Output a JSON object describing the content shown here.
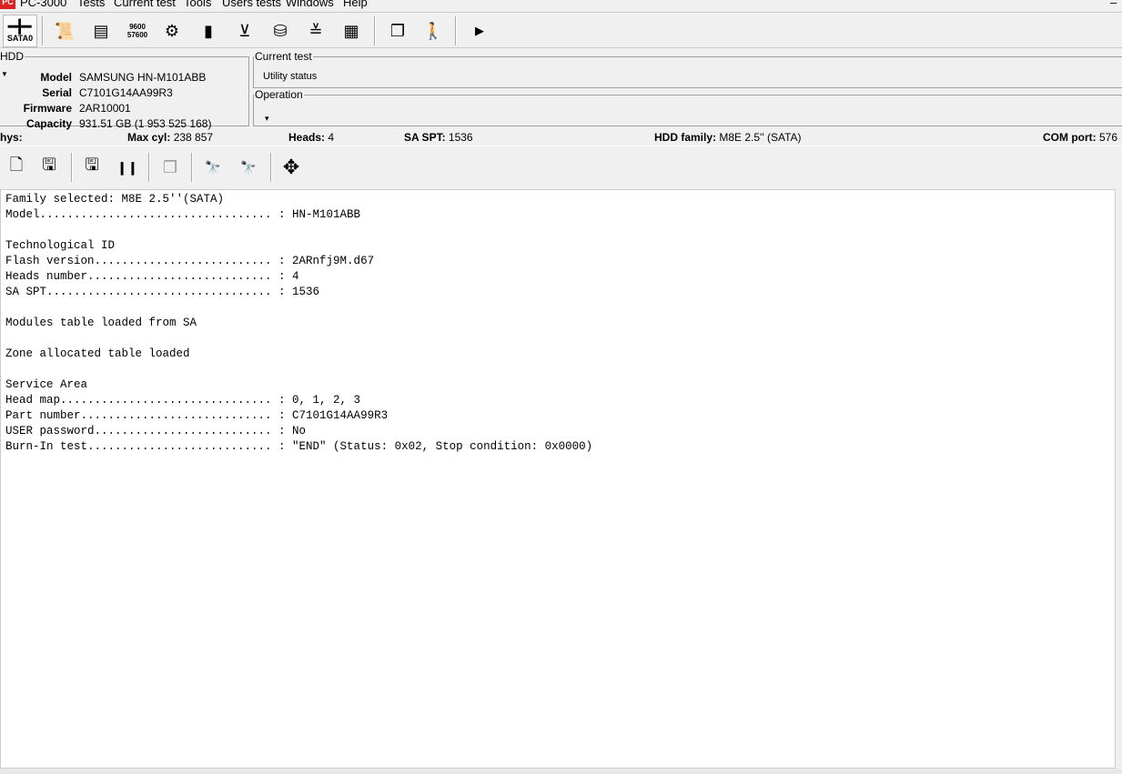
{
  "menu": {
    "app": "PC-3000",
    "items": [
      "Tests",
      "Current test",
      "Tools",
      "Users tests",
      "Windows",
      "Help"
    ]
  },
  "toolbar": {
    "port_label": "SATA0",
    "icons": [
      "info-scroll-icon",
      "drive-card-icon",
      "baud-rate-icon",
      "settings-disk-icon",
      "chip-icon",
      "ruler-icon",
      "disk-drop-icon",
      "heads-icon",
      "grid-icon",
      "windows-icon",
      "exit-icon",
      "play-icon"
    ],
    "baud": [
      "9600",
      "57600"
    ]
  },
  "hdd": {
    "legend": "HDD",
    "model_label": "Model",
    "model": "SAMSUNG HN-M101ABB",
    "serial_label": "Serial",
    "serial": "C7101G14AA99R3",
    "firmware_label": "Firmware",
    "firmware": "2AR10001",
    "capacity_label": "Capacity",
    "capacity": "931.51 GB (1 953 525 168)"
  },
  "current_test": {
    "legend": "Current test",
    "value": "Utility status"
  },
  "operation": {
    "legend": "Operation",
    "value": "▾"
  },
  "status": {
    "phys_label": "hys:",
    "maxcyl_label": "Max cyl:",
    "maxcyl": "238 857",
    "heads_label": "Heads:",
    "heads": "4",
    "saspt_label": "SA SPT:",
    "saspt": "1536",
    "family_label": "HDD family:",
    "family": "M8E 2.5'' (SATA)",
    "com_label": "COM port:",
    "com": "576"
  },
  "log": {
    "lines": [
      "Family selected: M8E 2.5''(SATA)",
      "Model.................................. : HN-M101ABB",
      "",
      "Technological ID",
      "Flash version.......................... : 2ARnfj9M.d67",
      "Heads number........................... : 4",
      "SA SPT................................. : 1536",
      "",
      "Modules table loaded from SA",
      "",
      "Zone allocated table loaded",
      "",
      "Service Area",
      "Head map............................... : 0, 1, 2, 3",
      "Part number............................ : C7101G14AA99R3",
      "USER password.......................... : No",
      "Burn-In test........................... : \"END\" (Status: 0x02, Stop condition: 0x0000)"
    ]
  }
}
